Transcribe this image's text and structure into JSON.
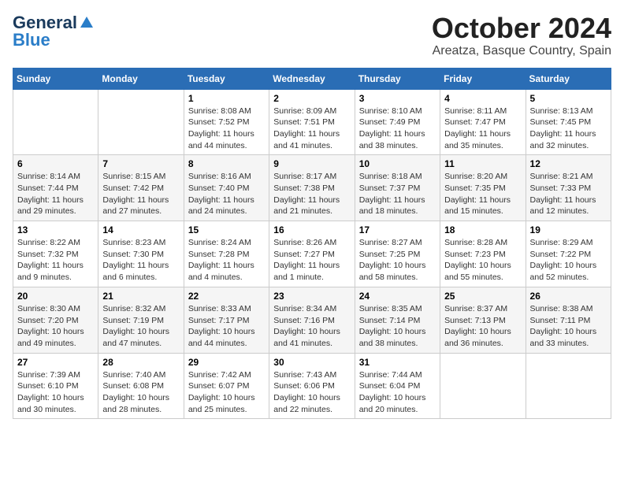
{
  "header": {
    "logo_general": "General",
    "logo_blue": "Blue",
    "month": "October 2024",
    "location": "Areatza, Basque Country, Spain"
  },
  "days_of_week": [
    "Sunday",
    "Monday",
    "Tuesday",
    "Wednesday",
    "Thursday",
    "Friday",
    "Saturday"
  ],
  "weeks": [
    [
      {
        "day": "",
        "info": ""
      },
      {
        "day": "",
        "info": ""
      },
      {
        "day": "1",
        "info": "Sunrise: 8:08 AM\nSunset: 7:52 PM\nDaylight: 11 hours and 44 minutes."
      },
      {
        "day": "2",
        "info": "Sunrise: 8:09 AM\nSunset: 7:51 PM\nDaylight: 11 hours and 41 minutes."
      },
      {
        "day": "3",
        "info": "Sunrise: 8:10 AM\nSunset: 7:49 PM\nDaylight: 11 hours and 38 minutes."
      },
      {
        "day": "4",
        "info": "Sunrise: 8:11 AM\nSunset: 7:47 PM\nDaylight: 11 hours and 35 minutes."
      },
      {
        "day": "5",
        "info": "Sunrise: 8:13 AM\nSunset: 7:45 PM\nDaylight: 11 hours and 32 minutes."
      }
    ],
    [
      {
        "day": "6",
        "info": "Sunrise: 8:14 AM\nSunset: 7:44 PM\nDaylight: 11 hours and 29 minutes."
      },
      {
        "day": "7",
        "info": "Sunrise: 8:15 AM\nSunset: 7:42 PM\nDaylight: 11 hours and 27 minutes."
      },
      {
        "day": "8",
        "info": "Sunrise: 8:16 AM\nSunset: 7:40 PM\nDaylight: 11 hours and 24 minutes."
      },
      {
        "day": "9",
        "info": "Sunrise: 8:17 AM\nSunset: 7:38 PM\nDaylight: 11 hours and 21 minutes."
      },
      {
        "day": "10",
        "info": "Sunrise: 8:18 AM\nSunset: 7:37 PM\nDaylight: 11 hours and 18 minutes."
      },
      {
        "day": "11",
        "info": "Sunrise: 8:20 AM\nSunset: 7:35 PM\nDaylight: 11 hours and 15 minutes."
      },
      {
        "day": "12",
        "info": "Sunrise: 8:21 AM\nSunset: 7:33 PM\nDaylight: 11 hours and 12 minutes."
      }
    ],
    [
      {
        "day": "13",
        "info": "Sunrise: 8:22 AM\nSunset: 7:32 PM\nDaylight: 11 hours and 9 minutes."
      },
      {
        "day": "14",
        "info": "Sunrise: 8:23 AM\nSunset: 7:30 PM\nDaylight: 11 hours and 6 minutes."
      },
      {
        "day": "15",
        "info": "Sunrise: 8:24 AM\nSunset: 7:28 PM\nDaylight: 11 hours and 4 minutes."
      },
      {
        "day": "16",
        "info": "Sunrise: 8:26 AM\nSunset: 7:27 PM\nDaylight: 11 hours and 1 minute."
      },
      {
        "day": "17",
        "info": "Sunrise: 8:27 AM\nSunset: 7:25 PM\nDaylight: 10 hours and 58 minutes."
      },
      {
        "day": "18",
        "info": "Sunrise: 8:28 AM\nSunset: 7:23 PM\nDaylight: 10 hours and 55 minutes."
      },
      {
        "day": "19",
        "info": "Sunrise: 8:29 AM\nSunset: 7:22 PM\nDaylight: 10 hours and 52 minutes."
      }
    ],
    [
      {
        "day": "20",
        "info": "Sunrise: 8:30 AM\nSunset: 7:20 PM\nDaylight: 10 hours and 49 minutes."
      },
      {
        "day": "21",
        "info": "Sunrise: 8:32 AM\nSunset: 7:19 PM\nDaylight: 10 hours and 47 minutes."
      },
      {
        "day": "22",
        "info": "Sunrise: 8:33 AM\nSunset: 7:17 PM\nDaylight: 10 hours and 44 minutes."
      },
      {
        "day": "23",
        "info": "Sunrise: 8:34 AM\nSunset: 7:16 PM\nDaylight: 10 hours and 41 minutes."
      },
      {
        "day": "24",
        "info": "Sunrise: 8:35 AM\nSunset: 7:14 PM\nDaylight: 10 hours and 38 minutes."
      },
      {
        "day": "25",
        "info": "Sunrise: 8:37 AM\nSunset: 7:13 PM\nDaylight: 10 hours and 36 minutes."
      },
      {
        "day": "26",
        "info": "Sunrise: 8:38 AM\nSunset: 7:11 PM\nDaylight: 10 hours and 33 minutes."
      }
    ],
    [
      {
        "day": "27",
        "info": "Sunrise: 7:39 AM\nSunset: 6:10 PM\nDaylight: 10 hours and 30 minutes."
      },
      {
        "day": "28",
        "info": "Sunrise: 7:40 AM\nSunset: 6:08 PM\nDaylight: 10 hours and 28 minutes."
      },
      {
        "day": "29",
        "info": "Sunrise: 7:42 AM\nSunset: 6:07 PM\nDaylight: 10 hours and 25 minutes."
      },
      {
        "day": "30",
        "info": "Sunrise: 7:43 AM\nSunset: 6:06 PM\nDaylight: 10 hours and 22 minutes."
      },
      {
        "day": "31",
        "info": "Sunrise: 7:44 AM\nSunset: 6:04 PM\nDaylight: 10 hours and 20 minutes."
      },
      {
        "day": "",
        "info": ""
      },
      {
        "day": "",
        "info": ""
      }
    ]
  ]
}
